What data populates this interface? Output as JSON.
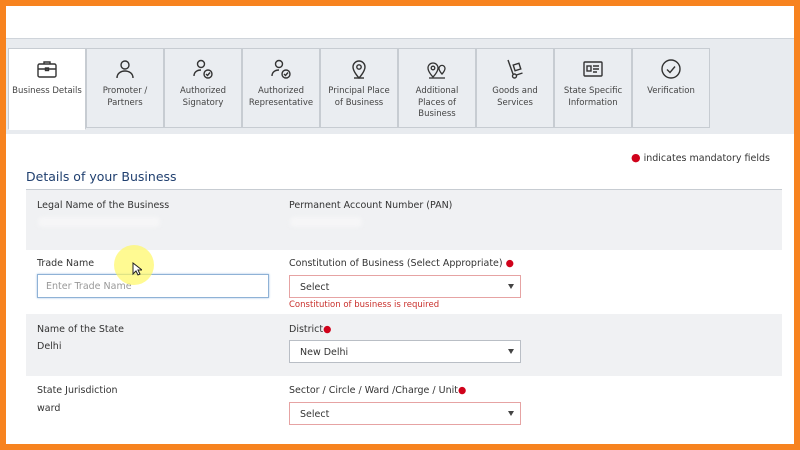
{
  "tabs": [
    {
      "label": "Business Details",
      "icon": "briefcase-icon",
      "active": true
    },
    {
      "label": "Promoter / Partners",
      "icon": "person-icon",
      "active": false
    },
    {
      "label": "Authorized Signatory",
      "icon": "person-check-icon",
      "active": false
    },
    {
      "label": "Authorized Representative",
      "icon": "person-check-icon",
      "active": false
    },
    {
      "label": "Principal Place of Business",
      "icon": "map-pin-icon",
      "active": false
    },
    {
      "label": "Additional Places of Business",
      "icon": "map-pins-icon",
      "active": false
    },
    {
      "label": "Goods and Services",
      "icon": "hand-truck-icon",
      "active": false
    },
    {
      "label": "State Specific Information",
      "icon": "id-card-icon",
      "active": false
    },
    {
      "label": "Verification",
      "icon": "check-circle-icon",
      "active": false
    }
  ],
  "mandatory_note": "indicates mandatory fields",
  "section_title": "Details of your Business",
  "fields": {
    "legal_name_label": "Legal Name of the Business",
    "pan_label": "Permanent Account Number (PAN)",
    "trade_name_label": "Trade Name",
    "trade_name_placeholder": "Enter Trade Name",
    "constitution_label": "Constitution of Business (Select Appropriate)",
    "constitution_value": "Select",
    "constitution_error": "Constitution of business is required",
    "state_label": "Name of the State",
    "state_value": "Delhi",
    "district_label": "District",
    "district_value": "New Delhi",
    "jurisdiction_label": "State Jurisdiction",
    "jurisdiction_value": "ward",
    "sector_label": "Sector / Circle / Ward /Charge / Unit",
    "sector_value": "Select"
  },
  "colors": {
    "frame_border": "#f7831f",
    "title": "#1f3f6f",
    "required": "#d0021b",
    "error_text": "#c9302c"
  }
}
